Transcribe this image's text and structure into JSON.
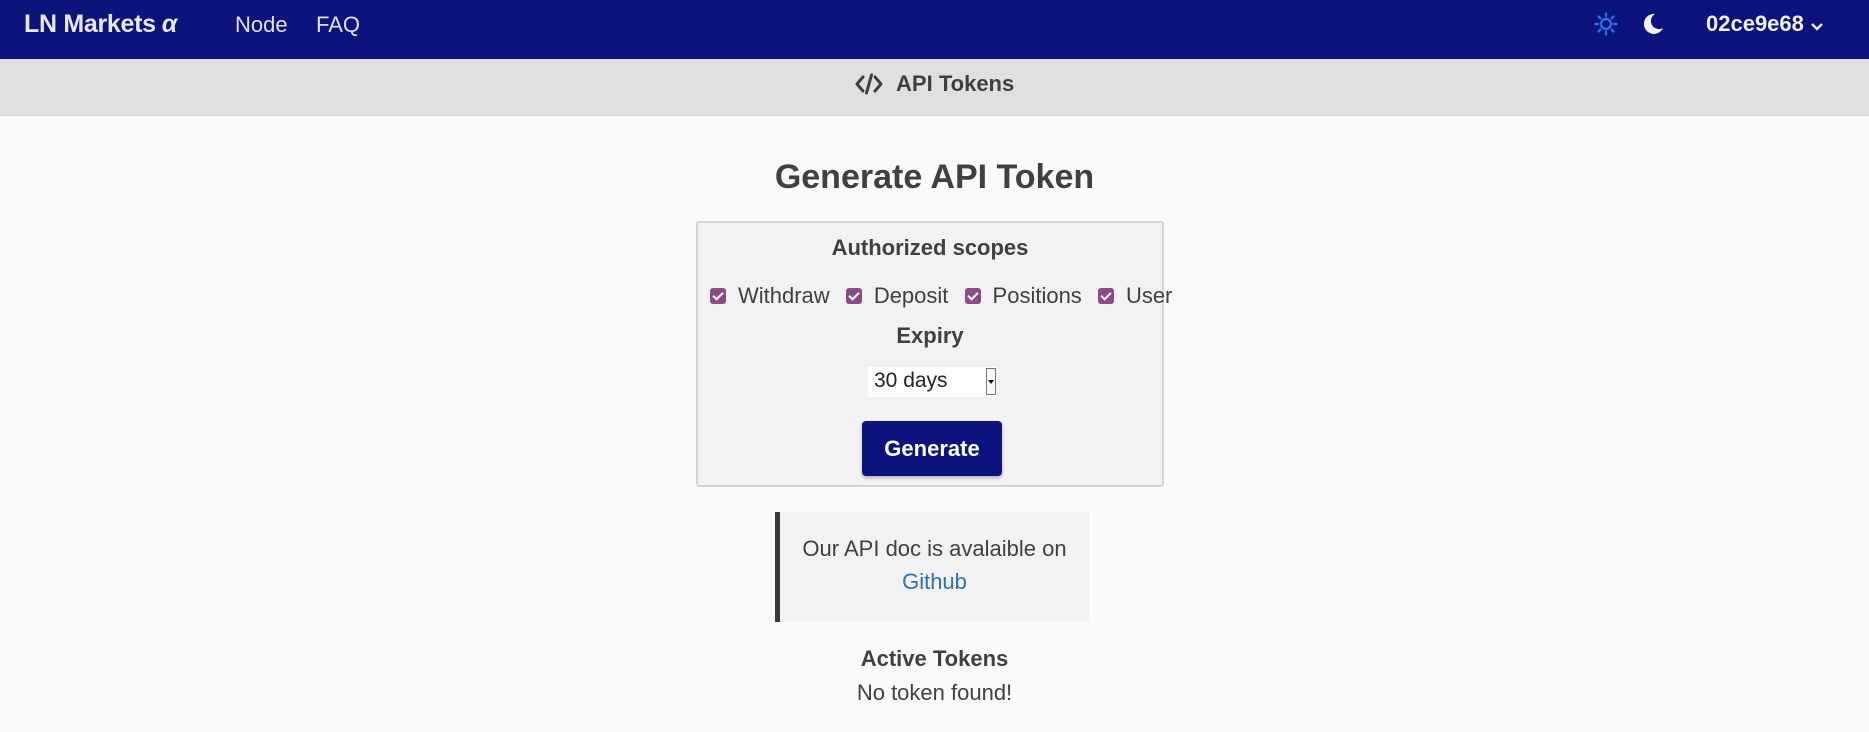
{
  "navbar": {
    "brand": "LN Markets",
    "brand_suffix": "α",
    "links": [
      "Node",
      "FAQ"
    ],
    "user": "02ce9e68",
    "icons": {
      "sun": "sun-icon",
      "moon": "moon-icon",
      "chevron": "chevron-down-icon"
    },
    "colors": {
      "background": "#0c137d",
      "sun": "#2f6fe0"
    }
  },
  "subheader": {
    "title": "API Tokens",
    "icon": "code-icon"
  },
  "main": {
    "title": "Generate API Token",
    "scopes_label": "Authorized scopes",
    "scopes": [
      {
        "label": "Withdraw",
        "checked": true
      },
      {
        "label": "Deposit",
        "checked": true
      },
      {
        "label": "Positions",
        "checked": true
      },
      {
        "label": "User",
        "checked": true
      }
    ],
    "expiry_label": "Expiry",
    "expiry_value": "30 days",
    "generate_label": "Generate",
    "note_text": "Our API doc is avalaible on",
    "note_link": "Github",
    "active_tokens_label": "Active Tokens",
    "no_tokens_message": "No token found!",
    "colors": {
      "checkbox": "#8a4b86",
      "button": "#0c137d",
      "link": "#2a6fb8"
    }
  }
}
